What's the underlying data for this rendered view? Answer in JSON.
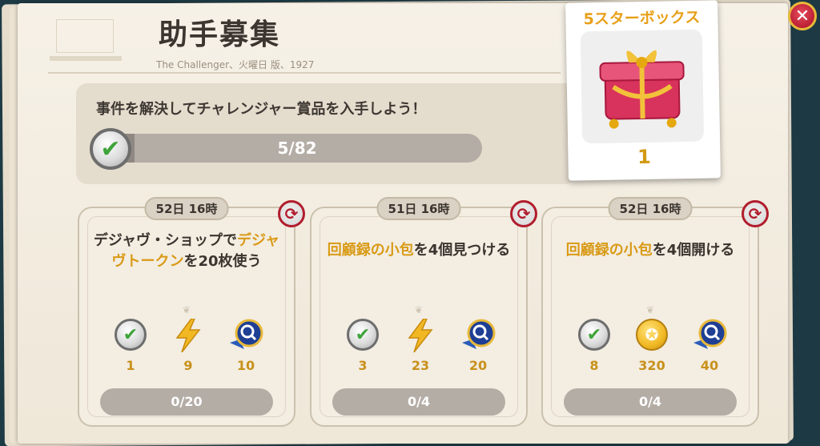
{
  "header": {
    "title": "助手募集",
    "subtitle": "The Challenger、火曜日 版、1927"
  },
  "progress": {
    "instruction": "事件を解決してチャレンジャー賞品を入手しよう！",
    "current": 5,
    "total": 82,
    "label": "5/82"
  },
  "reward_box": {
    "title": "5スターボックス",
    "count": "1"
  },
  "tasks": [
    {
      "timer": "52日 16時",
      "desc_prefix": "デジャヴ・ショップで",
      "desc_highlight": "デジャヴトークン",
      "desc_suffix": "を20枚使う",
      "rewards": [
        "1",
        "9",
        "10"
      ],
      "progress_label": "0/20",
      "progress_fraction": 0
    },
    {
      "timer": "51日 16時",
      "desc_prefix": "",
      "desc_highlight": "回顧録の小包",
      "desc_suffix": "を4個見つける",
      "rewards": [
        "3",
        "23",
        "20"
      ],
      "progress_label": "0/4",
      "progress_fraction": 0
    },
    {
      "timer": "52日 16時",
      "desc_prefix": "",
      "desc_highlight": "回顧録の小包",
      "desc_suffix": "を4個開ける",
      "rewards": [
        "8",
        "320",
        "40"
      ],
      "progress_label": "0/4",
      "progress_fraction": 0
    }
  ],
  "colors": {
    "accent": "#d99a16",
    "close": "#b3192f",
    "background": "#1d3a44"
  },
  "icons": [
    "check-medal-icon",
    "lightning-icon",
    "magnifier-badge-icon",
    "coin-icon",
    "refresh-icon",
    "close-icon",
    "gift-box-icon"
  ]
}
